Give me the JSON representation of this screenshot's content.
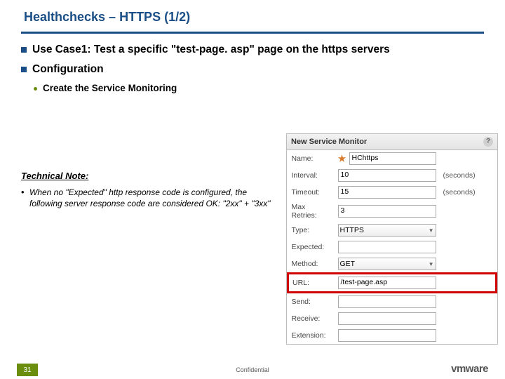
{
  "title": "Healthchecks – HTTPS (1/2)",
  "bullets": {
    "b1a": "Use Case1: Test a specific \"test-page. asp\" page on the https servers",
    "b1b": "Configuration",
    "b2a": "Create the Service Monitoring"
  },
  "tech": {
    "heading": "Technical Note:",
    "note": "When no \"Expected\" http response code is configured, the following server response code are considered OK: \"2xx\" + \"3xx\""
  },
  "panel": {
    "header": "New Service Monitor",
    "rows": {
      "name": {
        "label": "Name:",
        "value": "HChttps"
      },
      "interval": {
        "label": "Interval:",
        "value": "10",
        "unit": "(seconds)"
      },
      "timeout": {
        "label": "Timeout:",
        "value": "15",
        "unit": "(seconds)"
      },
      "maxretries": {
        "label": "Max Retries:",
        "value": "3"
      },
      "type": {
        "label": "Type:",
        "value": "HTTPS"
      },
      "expected": {
        "label": "Expected:"
      },
      "method": {
        "label": "Method:",
        "value": "GET"
      },
      "url": {
        "label": "URL:",
        "value": "/test-page.asp"
      },
      "send": {
        "label": "Send:"
      },
      "receive": {
        "label": "Receive:"
      },
      "extension": {
        "label": "Extension:"
      }
    }
  },
  "footer": {
    "page": "31",
    "confidential": "Confidential",
    "brand": "vmware"
  }
}
